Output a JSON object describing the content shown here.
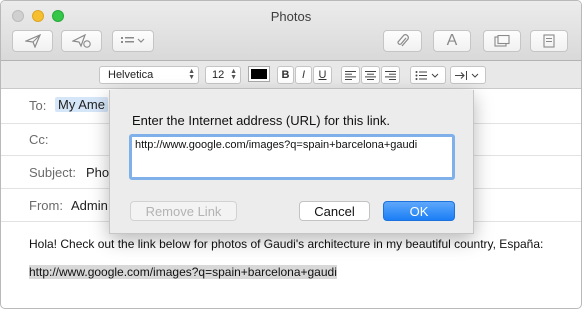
{
  "window": {
    "title": "Photos"
  },
  "toolbar": {
    "buttons": [
      {
        "name": "send-icon"
      },
      {
        "name": "reply-icon"
      },
      {
        "name": "list-icon"
      },
      {
        "name": "attach-icon"
      },
      {
        "name": "font-icon"
      },
      {
        "name": "window-icon"
      },
      {
        "name": "template-icon"
      }
    ],
    "font_glyph": "A"
  },
  "formatbar": {
    "font_family": "Helvetica",
    "font_size": "12",
    "bold": "B",
    "italic": "I",
    "underline": "U",
    "text_color": "#000000"
  },
  "headers": {
    "to_label": "To:",
    "to_value": "My Ame",
    "cc_label": "Cc:",
    "subject_label": "Subject:",
    "subject_value": "Pho",
    "from_label": "From:",
    "from_value": "Admin"
  },
  "message": {
    "line1": "Hola! Check out the link below for photos of Gaudi's architecture in my beautiful country, España:",
    "link": "http://www.google.com/images?q=spain+barcelona+gaudi"
  },
  "dialog": {
    "prompt": "Enter the Internet address (URL) for this link.",
    "url_value": "http://www.google.com/images?q=spain+barcelona+gaudi",
    "remove_label": "Remove Link",
    "cancel_label": "Cancel",
    "ok_label": "OK",
    "accent": "#1a7ef5"
  }
}
